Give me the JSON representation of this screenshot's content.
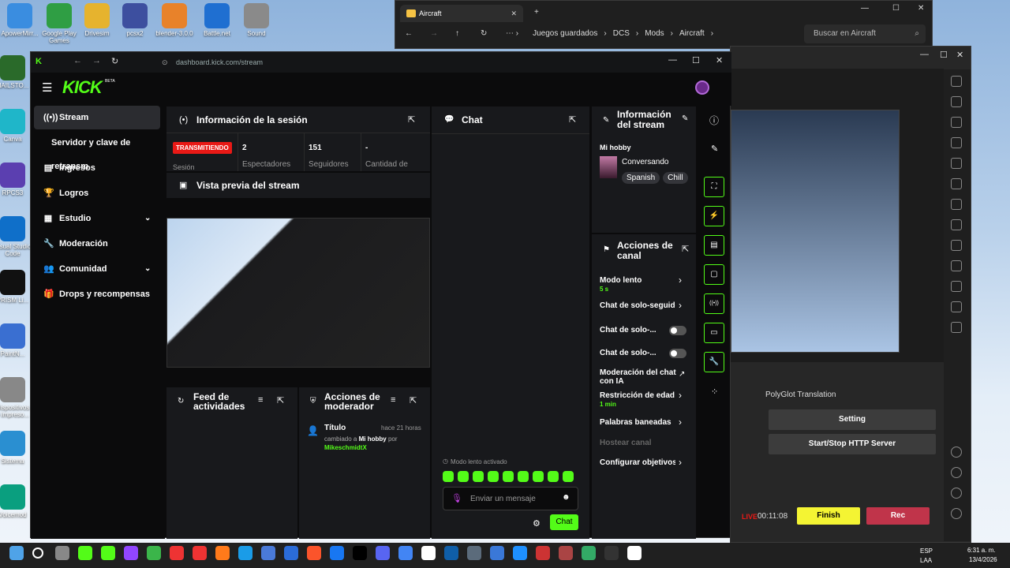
{
  "desktop": {
    "icons_top": [
      {
        "label": "ApowerMirr..."
      },
      {
        "label": "Google Play Games"
      },
      {
        "label": "Drivesim"
      },
      {
        "label": "pcsx2"
      },
      {
        "label": "blender-3.0.0"
      },
      {
        "label": "Battle.net"
      },
      {
        "label": "Sound"
      }
    ],
    "icons_left": [
      {
        "label": "HAILSTO..."
      },
      {
        "label": "Canva"
      },
      {
        "label": "RPCS3"
      },
      {
        "label": "Visual Studio Code"
      },
      {
        "label": "PRISM Li..."
      },
      {
        "label": "PaintN..."
      },
      {
        "label": "Dispositivos e impreso..."
      },
      {
        "label": "Sistema"
      },
      {
        "label": "Voicemod"
      }
    ]
  },
  "explorer": {
    "tab_title": "Aircraft",
    "breadcrumb": [
      "Juegos guardados",
      "DCS",
      "Mods",
      "Aircraft"
    ],
    "search_placeholder": "Buscar en Aircraft"
  },
  "obs": {
    "dock_title": "PolyGlot Translation",
    "setting_label": "Setting",
    "http_label": "Start/Stop HTTP Server",
    "live_label": "LIVE",
    "live_time": "00:11:08",
    "finish_label": "Finish",
    "rec_label": "Rec"
  },
  "browser": {
    "url": "dashboard.kick.com/stream"
  },
  "kick": {
    "logo": "KICK",
    "logo_badge": "BETA",
    "sidebar": [
      {
        "label": "Stream",
        "icon": "((•))"
      },
      {
        "label": "Servidor y clave de retransm",
        "icon": ""
      },
      {
        "label": "Ingresos",
        "icon": "▤"
      },
      {
        "label": "Logros",
        "icon": "🏆"
      },
      {
        "label": "Estudio",
        "icon": "▦"
      },
      {
        "label": "Moderación",
        "icon": "🔧"
      },
      {
        "label": "Comunidad",
        "icon": "👥"
      },
      {
        "label": "Drops y recompensas",
        "icon": "🎁"
      }
    ],
    "session": {
      "title": "Información de la sesión",
      "status": "TRANSMITIENDO",
      "status_sub": "Sesión",
      "stats": [
        {
          "value": "2",
          "label": "Espectadores"
        },
        {
          "value": "151",
          "label": "Seguidores"
        },
        {
          "value": "-",
          "label": "Cantidad de"
        }
      ]
    },
    "preview_title": "Vista previa del stream",
    "feed_title": "Feed de actividades",
    "modactions": {
      "title": "Acciones de moderador",
      "item_title": "Título",
      "item_time": "hace 21 horas",
      "item_text1": "cambiado a",
      "item_value": "Mi hobby",
      "item_text2": "por",
      "item_user": "MikeschmidtX"
    },
    "chat": {
      "title": "Chat",
      "slow_mode": "Modo lento activado",
      "placeholder": "Enviar un mensaje",
      "send_label": "Chat"
    },
    "stream_info": {
      "title": "Información del stream",
      "stream_title": "Mi hobby",
      "category": "Conversando",
      "tags": [
        "Spanish",
        "Chill"
      ]
    },
    "channel_actions": {
      "title": "Acciones de canal",
      "items": [
        {
          "label": "Modo lento",
          "sub": "5 s"
        },
        {
          "label": "Chat de solo-seguido"
        },
        {
          "label": "Chat de solo-..."
        },
        {
          "label": "Chat de solo-..."
        },
        {
          "label": "Moderación del chat con IA"
        },
        {
          "label": "Restricción de edad",
          "sub": "1 min"
        },
        {
          "label": "Palabras baneadas"
        },
        {
          "label": "Hostear canal"
        },
        {
          "label": "Configurar objetivos"
        }
      ]
    }
  },
  "taskbar": {
    "lang": "ESP",
    "lang2": "LAA",
    "time": "6:31 a. m.",
    "date": "13/4/2026"
  },
  "colors": {
    "kick_green": "#53fc18",
    "live_red": "#e91916",
    "finish_yellow": "#f4f433",
    "rec_red": "#c0344a"
  }
}
